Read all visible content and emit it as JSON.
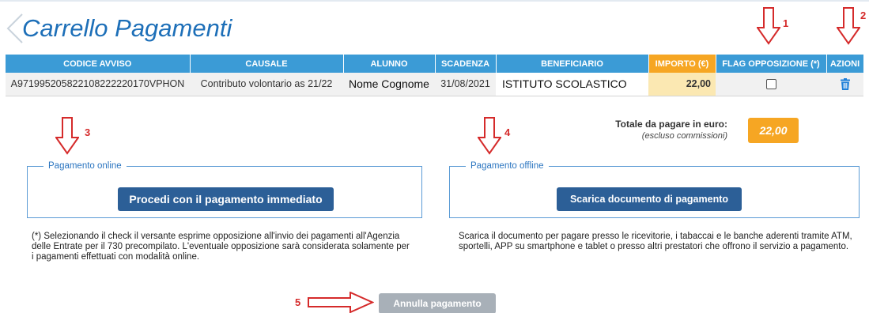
{
  "page": {
    "title": "Carrello Pagamenti"
  },
  "table": {
    "headers": [
      "CODICE AVVISO",
      "CAUSALE",
      "ALUNNO",
      "SCADENZA",
      "BENEFICIARIO",
      "IMPORTO (€)",
      "FLAG OPPOSIZIONE (*)",
      "AZIONI"
    ],
    "row": {
      "codice_avviso": "A971995205822108222220170VPHON",
      "causale": "Contributo volontario as 21/22",
      "alunno": "Nome Cognome",
      "scadenza": "31/08/2021",
      "beneficiario": "ISTITUTO SCOLASTICO",
      "importo": "22,00",
      "flag_opposizione_checked": false
    }
  },
  "markers": {
    "m1": "1",
    "m2": "2",
    "m3": "3",
    "m4": "4",
    "m5": "5"
  },
  "totale": {
    "label": "Totale da pagare in euro:",
    "sublabel": "(escluso commissioni)",
    "value": "22,00"
  },
  "online": {
    "legend": "Pagamento online",
    "button": "Procedi con il pagamento immediato"
  },
  "offline": {
    "legend": "Pagamento offline",
    "button": "Scarica documento di pagamento"
  },
  "notes": {
    "left": "(*) Selezionando il check il versante esprime opposizione all'invio dei pagamenti all'Agenzia delle Entrate per il 730 precompilato. L'eventuale opposizione sarà considerata solamente per i pagamenti effettuati con modalità online.",
    "right": "Scarica il documento per pagare presso le ricevitorie, i tabaccai e le banche aderenti tramite ATM, sportelli, APP su smartphone e tablet o presso altri prestatori che offrono il servizio a pagamento."
  },
  "cancel": {
    "label": "Annulla pagamento"
  },
  "colors": {
    "header_blue": "#3b9bd6",
    "importo_orange": "#f6a623",
    "button_navy": "#2c5f97",
    "marker_red": "#d52b2b",
    "cancel_gray": "#a8b0b8"
  }
}
